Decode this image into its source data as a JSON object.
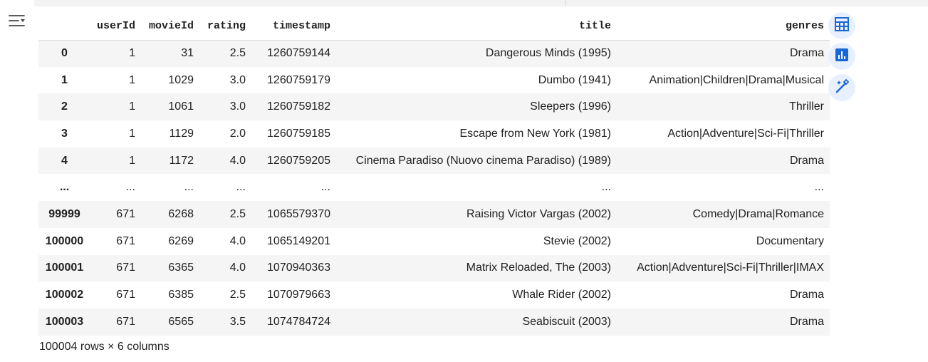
{
  "table": {
    "columns": [
      "userId",
      "movieId",
      "rating",
      "timestamp",
      "title",
      "genres"
    ],
    "rows": [
      {
        "index": "0",
        "cells": [
          "1",
          "31",
          "2.5",
          "1260759144",
          "Dangerous Minds (1995)",
          "Drama"
        ]
      },
      {
        "index": "1",
        "cells": [
          "1",
          "1029",
          "3.0",
          "1260759179",
          "Dumbo (1941)",
          "Animation|Children|Drama|Musical"
        ]
      },
      {
        "index": "2",
        "cells": [
          "1",
          "1061",
          "3.0",
          "1260759182",
          "Sleepers (1996)",
          "Thriller"
        ]
      },
      {
        "index": "3",
        "cells": [
          "1",
          "1129",
          "2.0",
          "1260759185",
          "Escape from New York (1981)",
          "Action|Adventure|Sci-Fi|Thriller"
        ]
      },
      {
        "index": "4",
        "cells": [
          "1",
          "1172",
          "4.0",
          "1260759205",
          "Cinema Paradiso (Nuovo cinema Paradiso) (1989)",
          "Drama"
        ]
      },
      {
        "index": "...",
        "cells": [
          "...",
          "...",
          "...",
          "...",
          "...",
          "..."
        ]
      },
      {
        "index": "99999",
        "cells": [
          "671",
          "6268",
          "2.5",
          "1065579370",
          "Raising Victor Vargas (2002)",
          "Comedy|Drama|Romance"
        ]
      },
      {
        "index": "100000",
        "cells": [
          "671",
          "6269",
          "4.0",
          "1065149201",
          "Stevie (2002)",
          "Documentary"
        ]
      },
      {
        "index": "100001",
        "cells": [
          "671",
          "6365",
          "4.0",
          "1070940363",
          "Matrix Reloaded, The (2003)",
          "Action|Adventure|Sci-Fi|Thriller|IMAX"
        ]
      },
      {
        "index": "100002",
        "cells": [
          "671",
          "6385",
          "2.5",
          "1070979663",
          "Whale Rider (2002)",
          "Drama"
        ]
      },
      {
        "index": "100003",
        "cells": [
          "671",
          "6565",
          "3.5",
          "1074784724",
          "Seabiscuit (2003)",
          "Drama"
        ]
      }
    ]
  },
  "summary": "100004 rows × 6 columns",
  "icons": {
    "toggle": "output-collapse-icon",
    "table": "interactive-table-icon",
    "chart": "bar-chart-icon",
    "magic": "magic-wand-icon"
  },
  "colors": {
    "accent": "#1967d2",
    "button_bg": "#e8f0fe",
    "stripe": "#f5f5f5"
  }
}
